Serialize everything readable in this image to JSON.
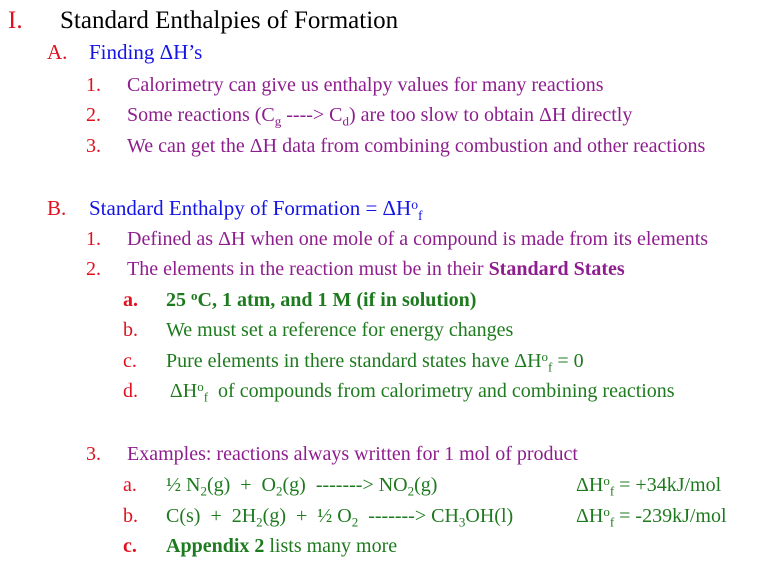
{
  "slide": {
    "section": {
      "marker": "I.",
      "title": "Standard Enthalpies of Formation"
    },
    "subsection_a": {
      "marker": "A.",
      "title_prefix": "Finding ",
      "title_symbol": "ΔH’s",
      "items": [
        {
          "marker": "1.",
          "text": "Calorimetry can give us enthalpy values for many reactions"
        },
        {
          "marker": "2.",
          "text_before": "Some reactions (C",
          "sub1": "g",
          "text_mid": " ----> C",
          "sub2": "d",
          "text_after": ") are too slow to obtain ΔH directly"
        },
        {
          "marker": "3.",
          "text": "We can get the ΔH data from combining combustion and other reactions"
        }
      ]
    },
    "subsection_b": {
      "marker": "B.",
      "title": "Standard Enthalpy of Formation = ΔH",
      "title_sup": "o",
      "title_sub": "f",
      "items": [
        {
          "marker": "1.",
          "text": "Defined as ΔH when one mole of a compound is made from its elements"
        },
        {
          "marker": "2.",
          "text": "The elements in the reaction must be in their ",
          "bold": "Standard States"
        }
      ],
      "subitems": [
        {
          "marker": "a.",
          "text_before": "25 ",
          "sup": "o",
          "text_after": "C, 1 atm, and 1 M (if in solution)"
        },
        {
          "marker": "b.",
          "text": "We must set a reference for energy changes"
        },
        {
          "marker": "c.",
          "text_before": "Pure elements in there standard states have ΔH",
          "sup": "o",
          "sub": "f",
          "text_after": " = 0"
        },
        {
          "marker": "d.",
          "text_before": " ΔH",
          "sup": "o",
          "sub": "f",
          "text_after": "  of compounds from calorimetry and combining reactions"
        }
      ],
      "examples": {
        "marker": "3.",
        "text": "Examples: reactions always written for 1 mol of product",
        "items": [
          {
            "marker": "a.",
            "reaction": [
              "½ N",
              "2",
              "(g)  +  O",
              "2",
              "(g)  -------> NO",
              "2",
              "(g)"
            ],
            "dh": "ΔH",
            "dh_sup": "o",
            "dh_sub": "f",
            "dh_value": " = +34kJ/mol"
          },
          {
            "marker": "b.",
            "reaction": [
              "C(s)  +  2H",
              "2",
              "(g)  +  ½ O",
              "2",
              "  -------> CH",
              "3",
              "OH(l)"
            ],
            "dh": "ΔH",
            "dh_sup": "o",
            "dh_sub": "f",
            "dh_value": " = -239kJ/mol"
          },
          {
            "marker": "c.",
            "bold": "Appendix 2",
            "text": " lists many more"
          }
        ]
      }
    }
  }
}
